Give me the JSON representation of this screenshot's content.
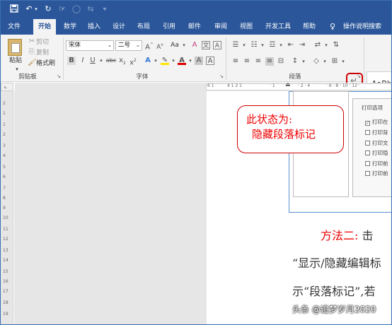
{
  "qat": {
    "icons": [
      "save-icon",
      "undo-icon",
      "redo-icon",
      "touch-icon",
      "circle-icon",
      "mode-icon",
      "customize-icon"
    ]
  },
  "tabs": [
    {
      "label": "文件"
    },
    {
      "label": "开始"
    },
    {
      "label": "数学"
    },
    {
      "label": "插入"
    },
    {
      "label": "设计"
    },
    {
      "label": "布局"
    },
    {
      "label": "引用"
    },
    {
      "label": "邮件"
    },
    {
      "label": "审阅"
    },
    {
      "label": "视图"
    },
    {
      "label": "开发工具"
    },
    {
      "label": "帮助"
    },
    {
      "label": "操作说明搜索"
    }
  ],
  "ribbon": {
    "clipboard": {
      "paste": "粘贴",
      "cut": "剪切",
      "copy": "复制",
      "format_painter": "格式刷",
      "group": "剪贴板"
    },
    "font": {
      "name": "宋体",
      "size": "二号",
      "group": "字体",
      "aa": "Aa"
    },
    "paragraph": {
      "group": "段落"
    },
    "styles": {
      "preview": "AaBb"
    }
  },
  "callout": {
    "line1": "此状态为:",
    "line2": "隐藏段落标记"
  },
  "print_options": {
    "title": "打印选项",
    "items": [
      "打印在",
      "打印背",
      "打印文",
      "打印隐",
      "打印前",
      "打印前"
    ]
  },
  "body": {
    "line1_label": "方法二:",
    "line1_rest": "击",
    "line2": "“显示/隐藏编辑标",
    "line3": "示“段落标记”,若"
  },
  "watermark": "头条 @追梦岁月2020",
  "ruler_left": [
    "2",
    "1",
    "1",
    "2",
    "3",
    "4",
    "5",
    "6",
    "7",
    "8",
    "9",
    "10",
    "11",
    "12",
    "13",
    "14",
    "15",
    "16",
    "17",
    "18",
    "19",
    "20"
  ],
  "colors": {
    "accent": "#2b579a",
    "callout_red": "#e00000",
    "body_red": "#e00000"
  }
}
